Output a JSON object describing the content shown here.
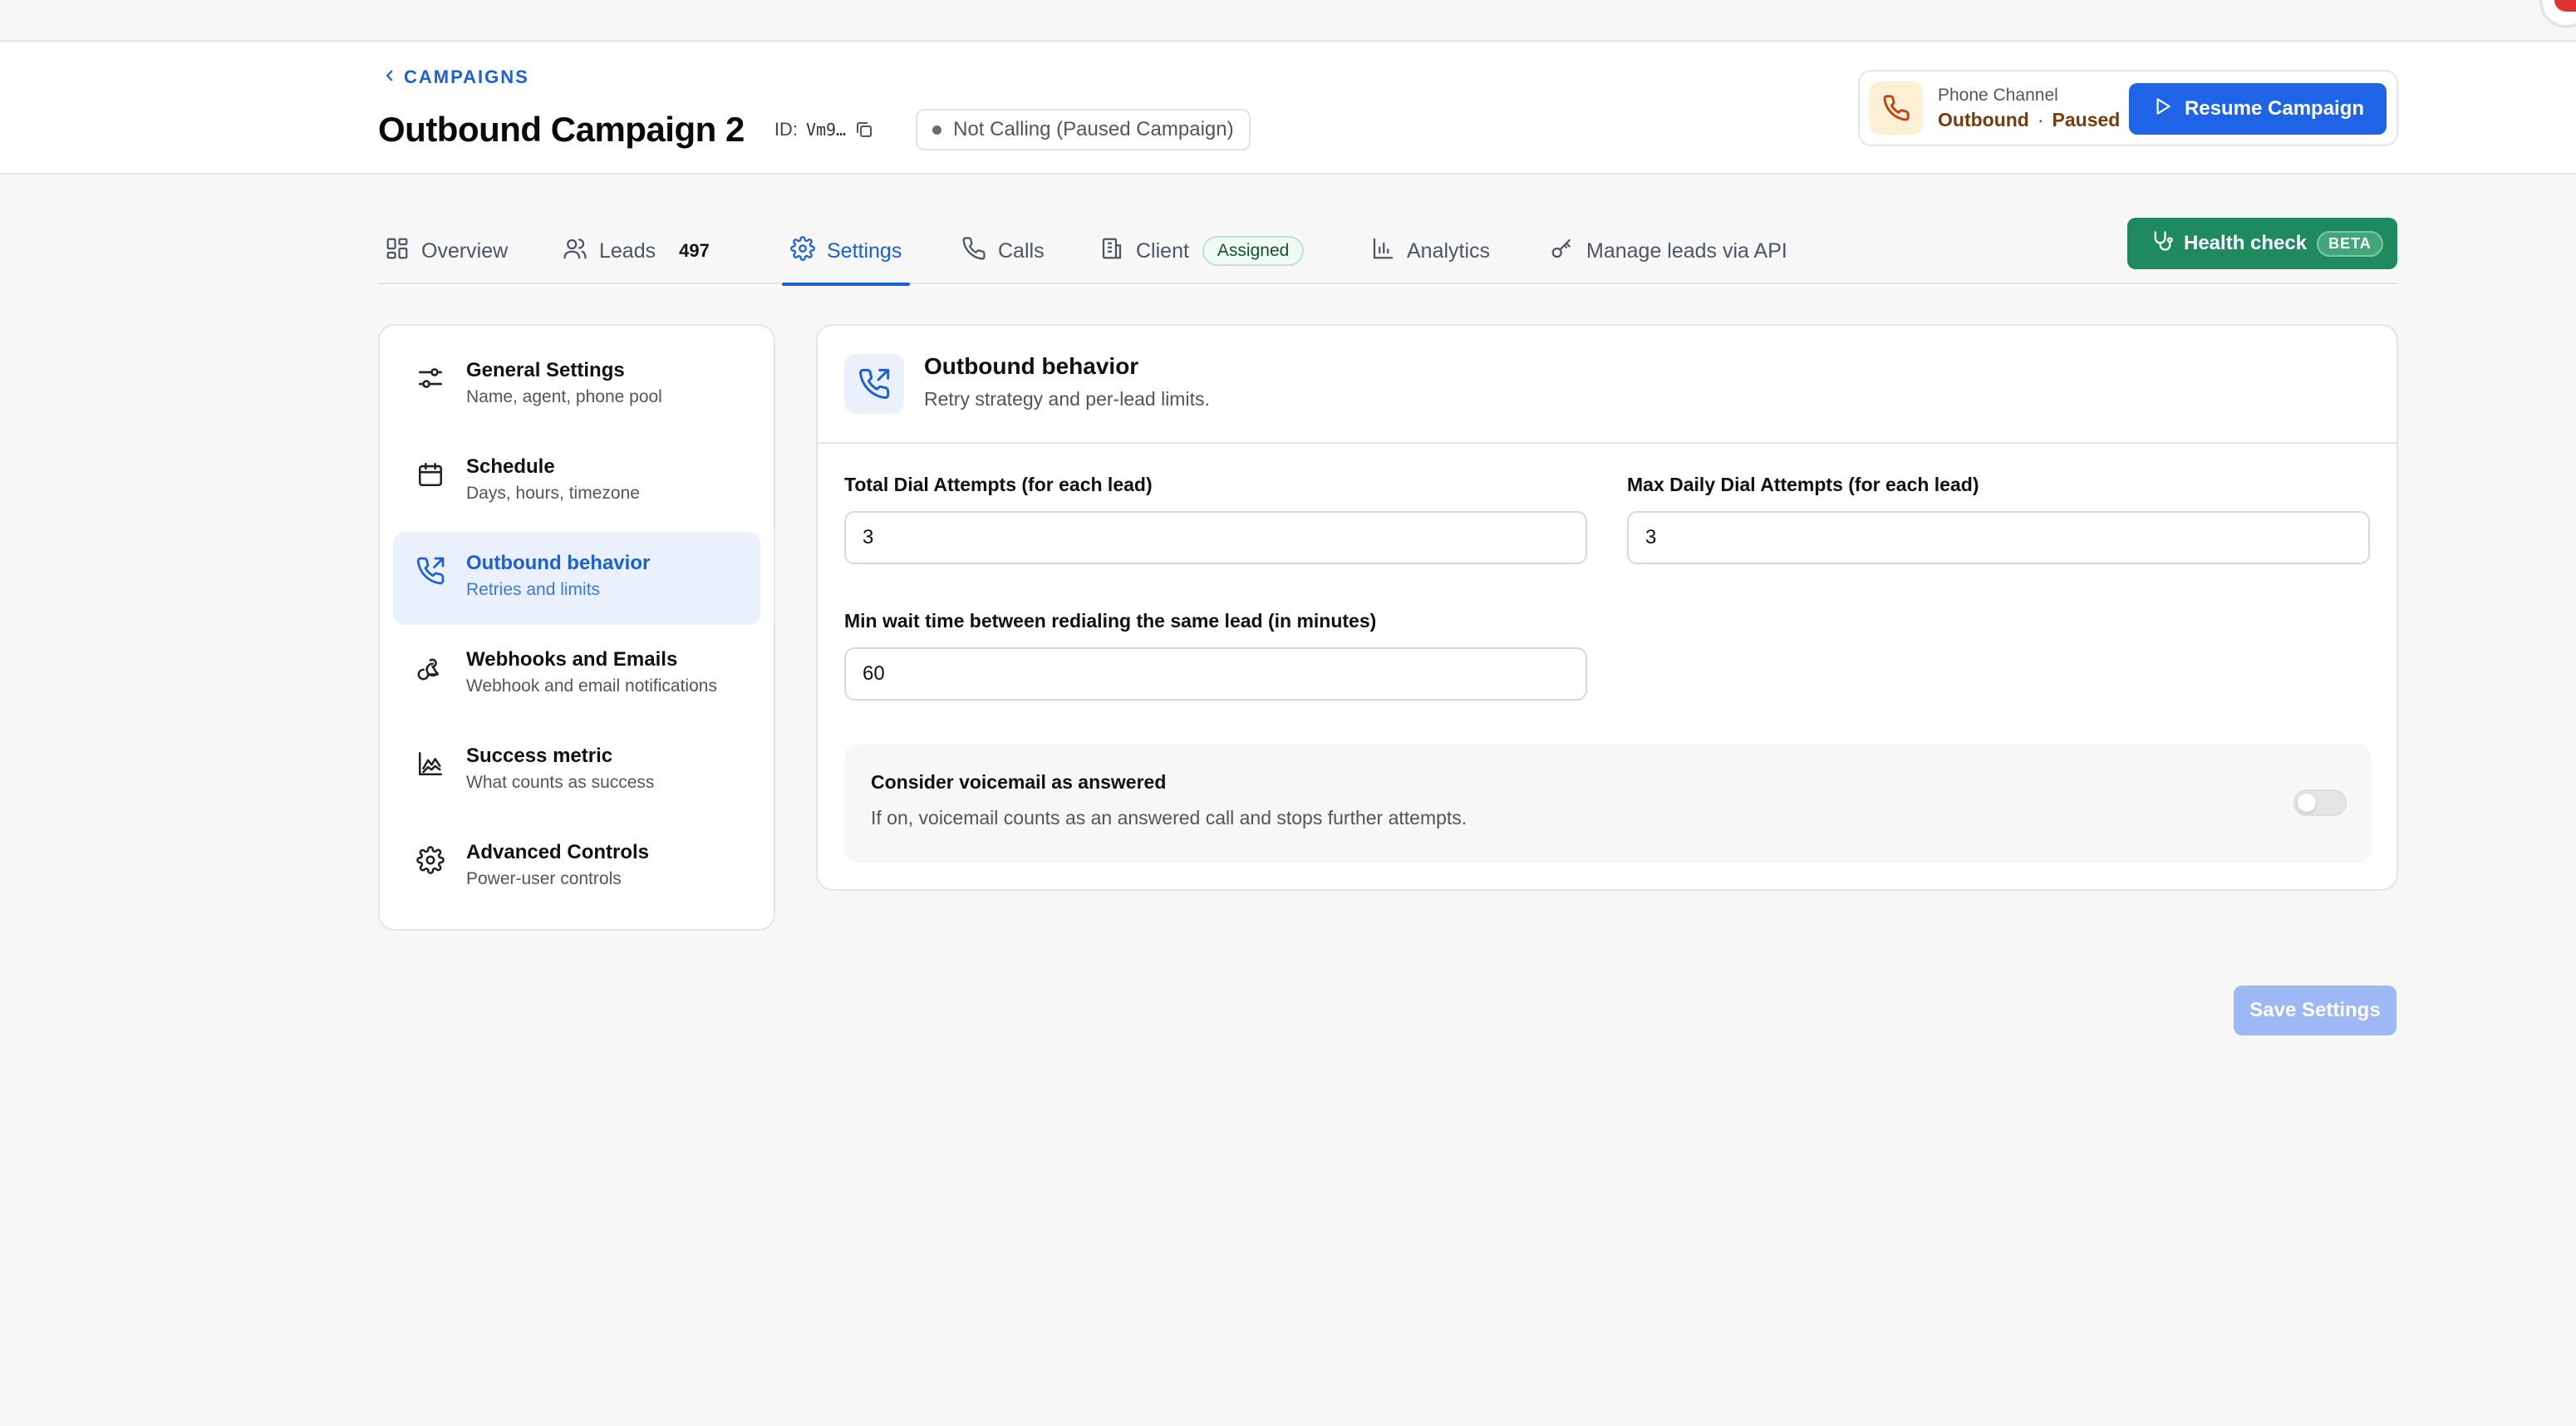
{
  "header": {
    "back_label": "CAMPAIGNS",
    "title": "Outbound Campaign 2",
    "id_label": "ID:",
    "id_value": "Vm9…",
    "status": "Not Calling (Paused Campaign)",
    "channel": {
      "label": "Phone Channel",
      "direction": "Outbound",
      "separator": "·",
      "state": "Paused"
    },
    "resume_label": "Resume Campaign"
  },
  "tabs": [
    {
      "label": "Overview",
      "icon": "grid-icon"
    },
    {
      "label": "Leads",
      "count": "497",
      "icon": "users-icon"
    },
    {
      "label": "Settings",
      "icon": "gear-icon",
      "active": true
    },
    {
      "label": "Calls",
      "icon": "phone-icon"
    },
    {
      "label": "Client",
      "badge": "Assigned",
      "icon": "building-icon"
    },
    {
      "label": "Analytics",
      "icon": "bar-chart-icon"
    },
    {
      "label": "Manage leads via API",
      "icon": "key-icon"
    }
  ],
  "health_check": {
    "label": "Health check",
    "badge": "BETA"
  },
  "sidebar": {
    "items": [
      {
        "title": "General Settings",
        "subtitle": "Name, agent, phone pool",
        "icon": "sliders-icon"
      },
      {
        "title": "Schedule",
        "subtitle": "Days, hours, timezone",
        "icon": "calendar-icon"
      },
      {
        "title": "Outbound behavior",
        "subtitle": "Retries and limits",
        "icon": "phone-outgoing-icon",
        "active": true
      },
      {
        "title": "Webhooks and Emails",
        "subtitle": "Webhook and email notifications",
        "icon": "webhook-icon"
      },
      {
        "title": "Success metric",
        "subtitle": "What counts as success",
        "icon": "area-chart-icon"
      },
      {
        "title": "Advanced Controls",
        "subtitle": "Power-user controls",
        "icon": "gear-icon"
      }
    ]
  },
  "main": {
    "title": "Outbound behavior",
    "subtitle": "Retry strategy and per-lead limits.",
    "fields": {
      "total_dial": {
        "label": "Total Dial Attempts (for each lead)",
        "value": "3"
      },
      "max_daily": {
        "label": "Max Daily Dial Attempts (for each lead)",
        "value": "3"
      },
      "min_wait": {
        "label": "Min wait time between redialing the same lead (in minutes)",
        "value": "60"
      }
    },
    "voicemail": {
      "title": "Consider voicemail as answered",
      "description": "If on, voicemail counts as an answered call and stops further attempts.",
      "enabled": false
    }
  },
  "save_label": "Save Settings",
  "colors": {
    "accent": "#1f63e6",
    "health": "#1f8a5f",
    "paused_text": "#7a3b06"
  }
}
